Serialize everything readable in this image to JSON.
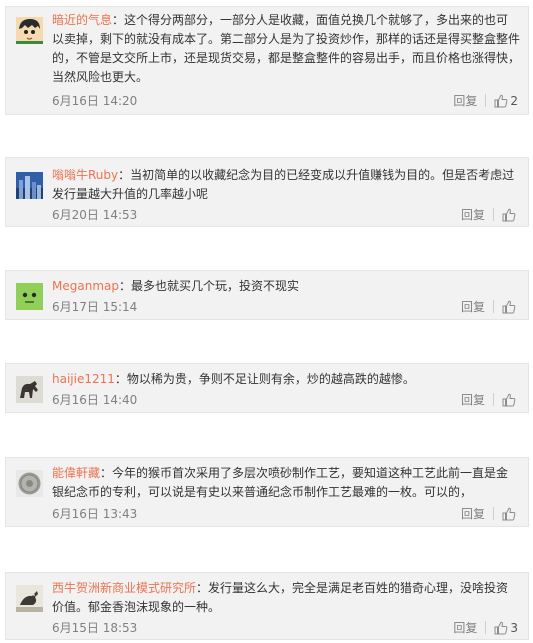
{
  "comments": [
    {
      "user": "暗近的气息",
      "text": "这个得分两部分，一部分人是收藏，面值兑换几个就够了，多出来的也可以卖掉，剩下的就没有成本了。第二部分人是为了投资炒作，那样的话还是得买整盒整件的，不管是文交所上市，还是现货交易，都是整盒整件的容易出手，而且价格也涨得快，当然风险也更大。",
      "time": "6月16日 14:20",
      "reply": "回复",
      "likes": "2",
      "avatar_icon": "cartoon-boy-avatar-icon"
    },
    {
      "user": "嗡嗡牛Ruby",
      "text": "当初简单的以收藏纪念为目的已经变成以升值赚钱为目的。但是否考虑过发行量越大升值的几率越小呢",
      "time": "6月20日 14:53",
      "reply": "回复",
      "likes": "",
      "avatar_icon": "city-skyline-avatar-icon"
    },
    {
      "user": "Meganmap",
      "text": "最多也就买几个玩，投资不现实",
      "time": "6月17日 15:14",
      "reply": "回复",
      "likes": "",
      "avatar_icon": "green-robot-avatar-icon"
    },
    {
      "user": "haijie1211",
      "text": "物以稀为贵，争则不足让则有余，炒的越高跌的越惨。",
      "time": "6月16日 14:40",
      "reply": "回复",
      "likes": "",
      "avatar_icon": "horse-avatar-icon"
    },
    {
      "user": "能偉軒藏",
      "text": "今年的猴币首次采用了多层次喷砂制作工艺，要知道这种工艺此前一直是金银纪念币的专利，可以说是有史以来普通纪念币制作工艺最难的一枚。可以的，",
      "time": "6月16日 13:43",
      "reply": "回复",
      "likes": "",
      "avatar_icon": "coin-avatar-icon"
    },
    {
      "user": "西牛贺洲新商业模式研究所",
      "text": "发行量这么大，完全是满足老百姓的猎奇心理，没啥投资价值。郁金香泡沫现象的一种。",
      "time": "6月15日 18:53",
      "reply": "回复",
      "likes": "3",
      "avatar_icon": "bird-avatar-icon"
    }
  ],
  "colors": {
    "username": "#eb7350",
    "meta": "#808080",
    "card_bg": "#f2f2f2"
  }
}
